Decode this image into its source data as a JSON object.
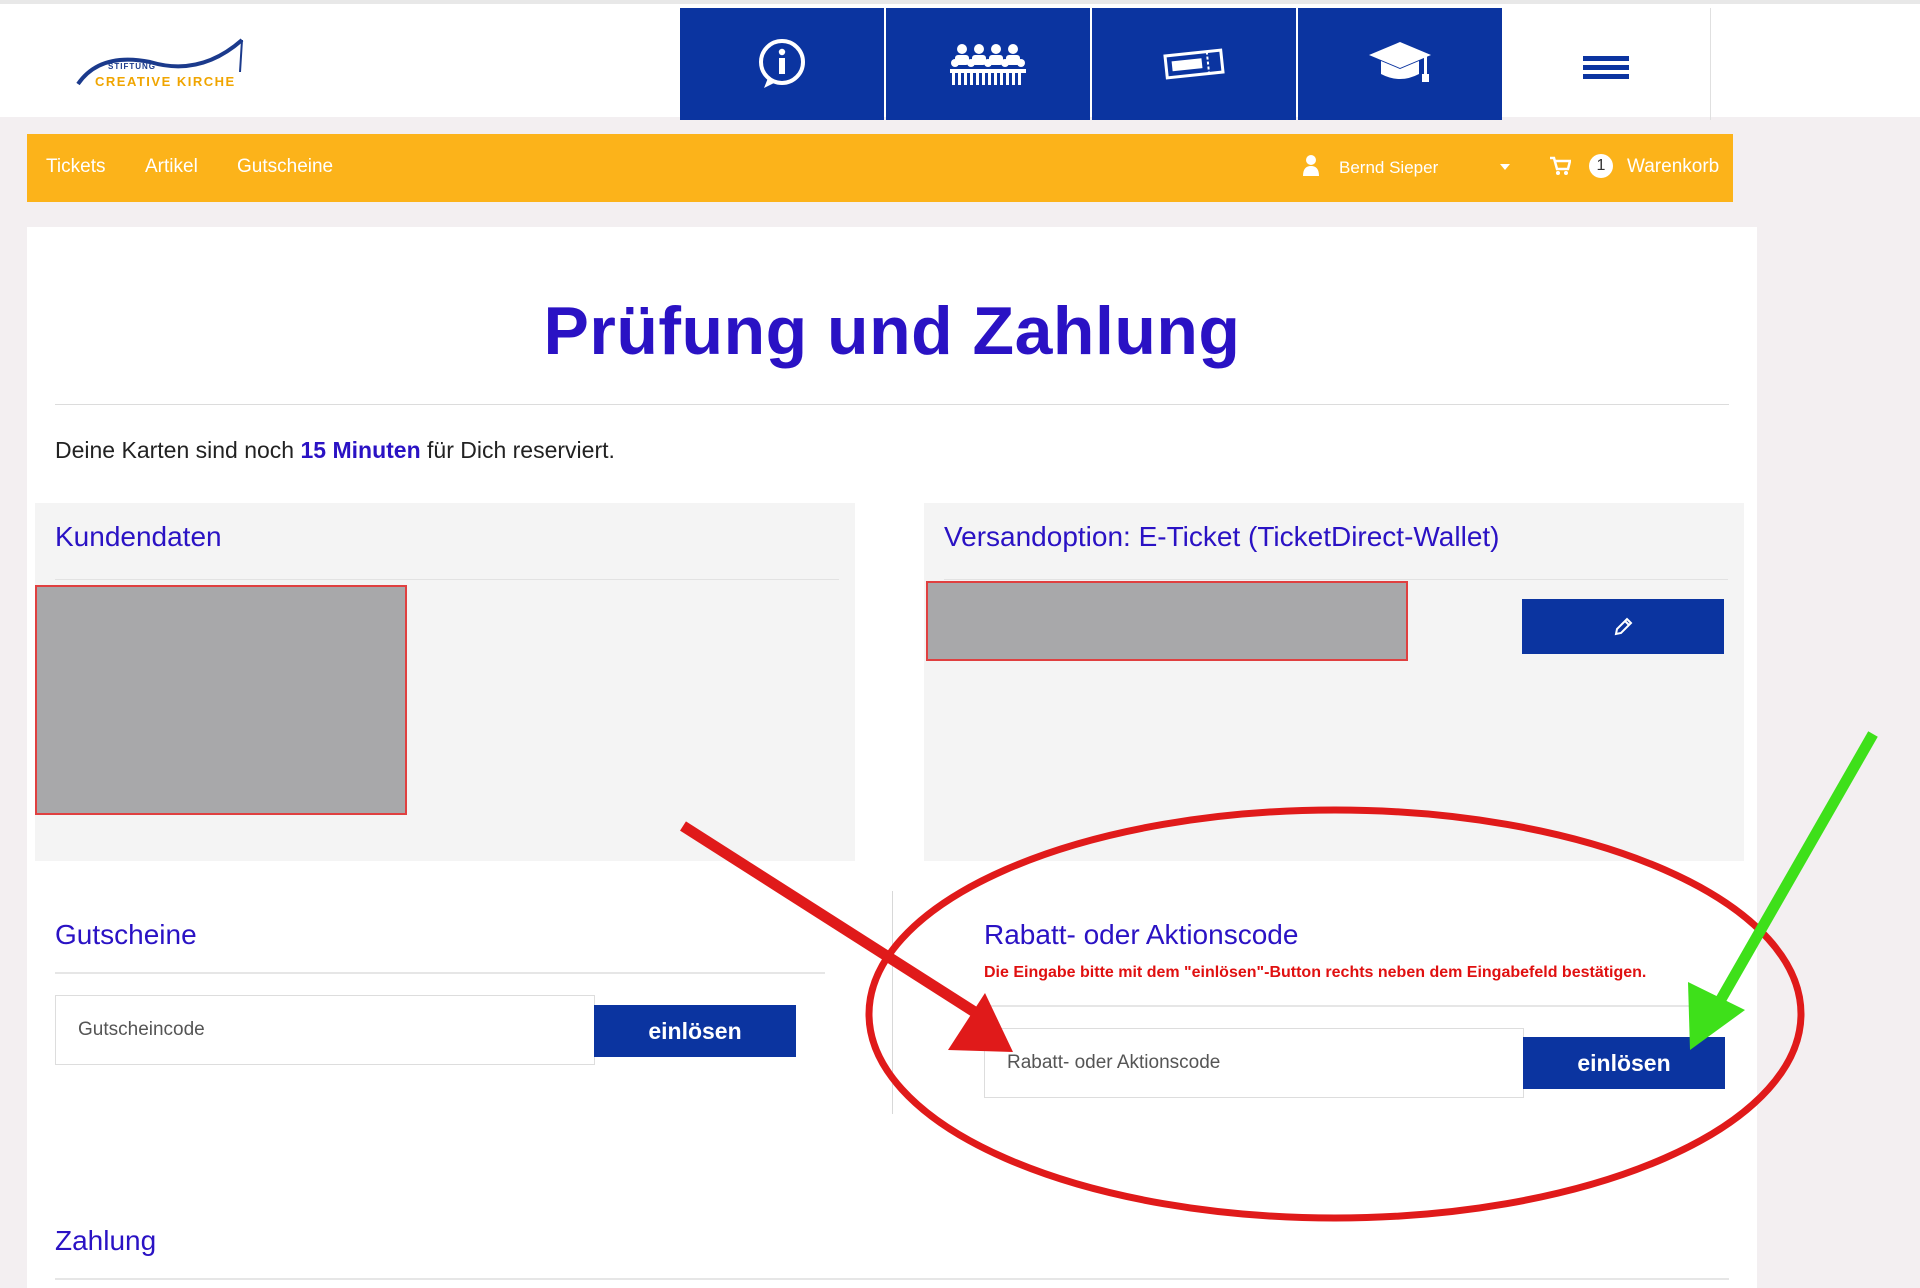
{
  "header": {
    "logo": {
      "top": "STIFTUNG",
      "main": "CREATIVE KIRCHE"
    },
    "nav_tiles": [
      {
        "icon": "info-icon"
      },
      {
        "icon": "choir-icon"
      },
      {
        "icon": "ticket-icon"
      },
      {
        "icon": "graduation-cap-icon"
      }
    ],
    "menu_icon": "hamburger-menu-icon",
    "accent_color": "#0b34a0"
  },
  "subnav": {
    "items": [
      "Tickets",
      "Artikel",
      "Gutscheine"
    ],
    "user_name": "Bernd Sieper",
    "cart_count": "1",
    "cart_label": "Warenkorb",
    "color": "#fcb31a"
  },
  "main": {
    "title": "Prüfung und Zahlung",
    "reserve_prefix": "Deine Karten sind noch ",
    "reserve_highlight": "15 Minuten",
    "reserve_suffix": " für Dich reserviert.",
    "customer": {
      "title": "Kundendaten"
    },
    "shipping": {
      "title": "Versandoption: E-Ticket (TicketDirect-Wallet)"
    },
    "vouchers": {
      "title": "Gutscheine",
      "placeholder": "Gutscheincode",
      "button": "einlösen"
    },
    "discount": {
      "title": "Rabatt- oder Aktionscode",
      "hint": "Die Eingabe bitte mit dem \"einlösen\"-Button rechts neben dem Eingabefeld bestätigen.",
      "placeholder": "Rabatt- oder Aktionscode",
      "button": "einlösen"
    },
    "payment": {
      "title": "Zahlung"
    },
    "title_color": "#2a12c4"
  },
  "annotations": {
    "ellipse_color": "#e01a1a",
    "arrow_red_color": "#e01a1a",
    "arrow_green_color": "#3ee01a"
  }
}
